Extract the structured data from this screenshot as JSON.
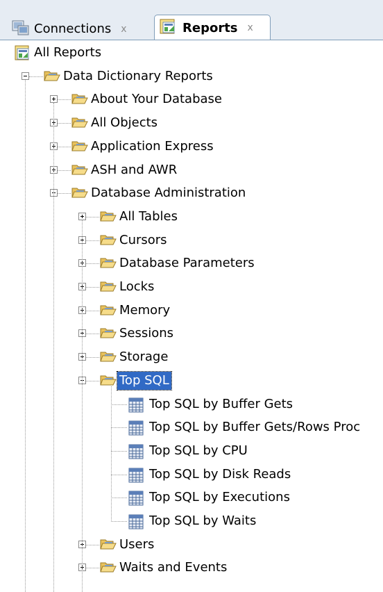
{
  "tabs": [
    {
      "label": "Connections",
      "close": "x",
      "icon": "connections-icon"
    },
    {
      "label": "Reports",
      "close": "x",
      "icon": "reports-icon"
    }
  ],
  "tree": {
    "root": "All Reports",
    "dictionary": "Data Dictionary Reports",
    "level1": [
      "About Your Database",
      "All Objects",
      "Application Express",
      "ASH and AWR",
      "Database Administration"
    ],
    "admin": [
      "All Tables",
      "Cursors",
      "Database Parameters",
      "Locks",
      "Memory",
      "Sessions",
      "Storage",
      "Top SQL"
    ],
    "top_sql": [
      "Top SQL by Buffer Gets",
      "Top SQL by Buffer Gets/Rows Proc",
      "Top SQL by CPU",
      "Top SQL by Disk Reads",
      "Top SQL by Executions",
      "Top SQL by Waits"
    ],
    "admin_tail": [
      "Users",
      "Waits and Events"
    ]
  },
  "colors": {
    "selection": "#316ac5",
    "folder": "#f3d27a",
    "report_icon": "#5b7fb8"
  }
}
